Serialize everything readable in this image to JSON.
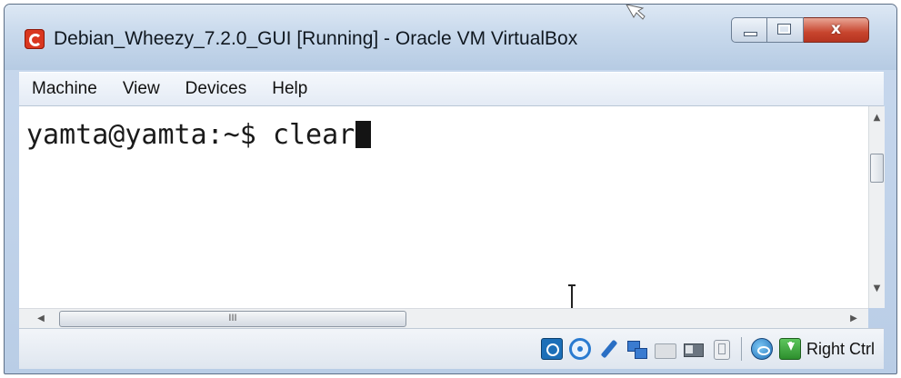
{
  "window": {
    "title": "Debian_Wheezy_7.2.0_GUI [Running] - Oracle VM VirtualBox",
    "close_glyph": "x",
    "icons": [
      "virtualbox-icon",
      "minimize-icon",
      "maximize-icon",
      "close-icon"
    ]
  },
  "menubar": {
    "items": [
      {
        "label": "Machine"
      },
      {
        "label": "View"
      },
      {
        "label": "Devices"
      },
      {
        "label": "Help"
      }
    ]
  },
  "terminal": {
    "prompt": "yamta@yamta:~$ ",
    "command": "clear"
  },
  "scrollbars": {
    "horizontal_thumb_grip": "III"
  },
  "statusbar": {
    "device_icons": [
      "hard-disk-icon",
      "optical-drive-icon",
      "usb-icon",
      "network-icon",
      "shared-folders-icon",
      "video-capture-icon",
      "capture-icon",
      "mouse-integration-icon",
      "keyboard-capture-icon"
    ],
    "host_key": "Right Ctrl"
  },
  "colors": {
    "titlebar": "#c8d9ec",
    "close_button": "#c8452e",
    "terminal_bg": "#ffffff",
    "terminal_fg": "#1a1a1a"
  }
}
